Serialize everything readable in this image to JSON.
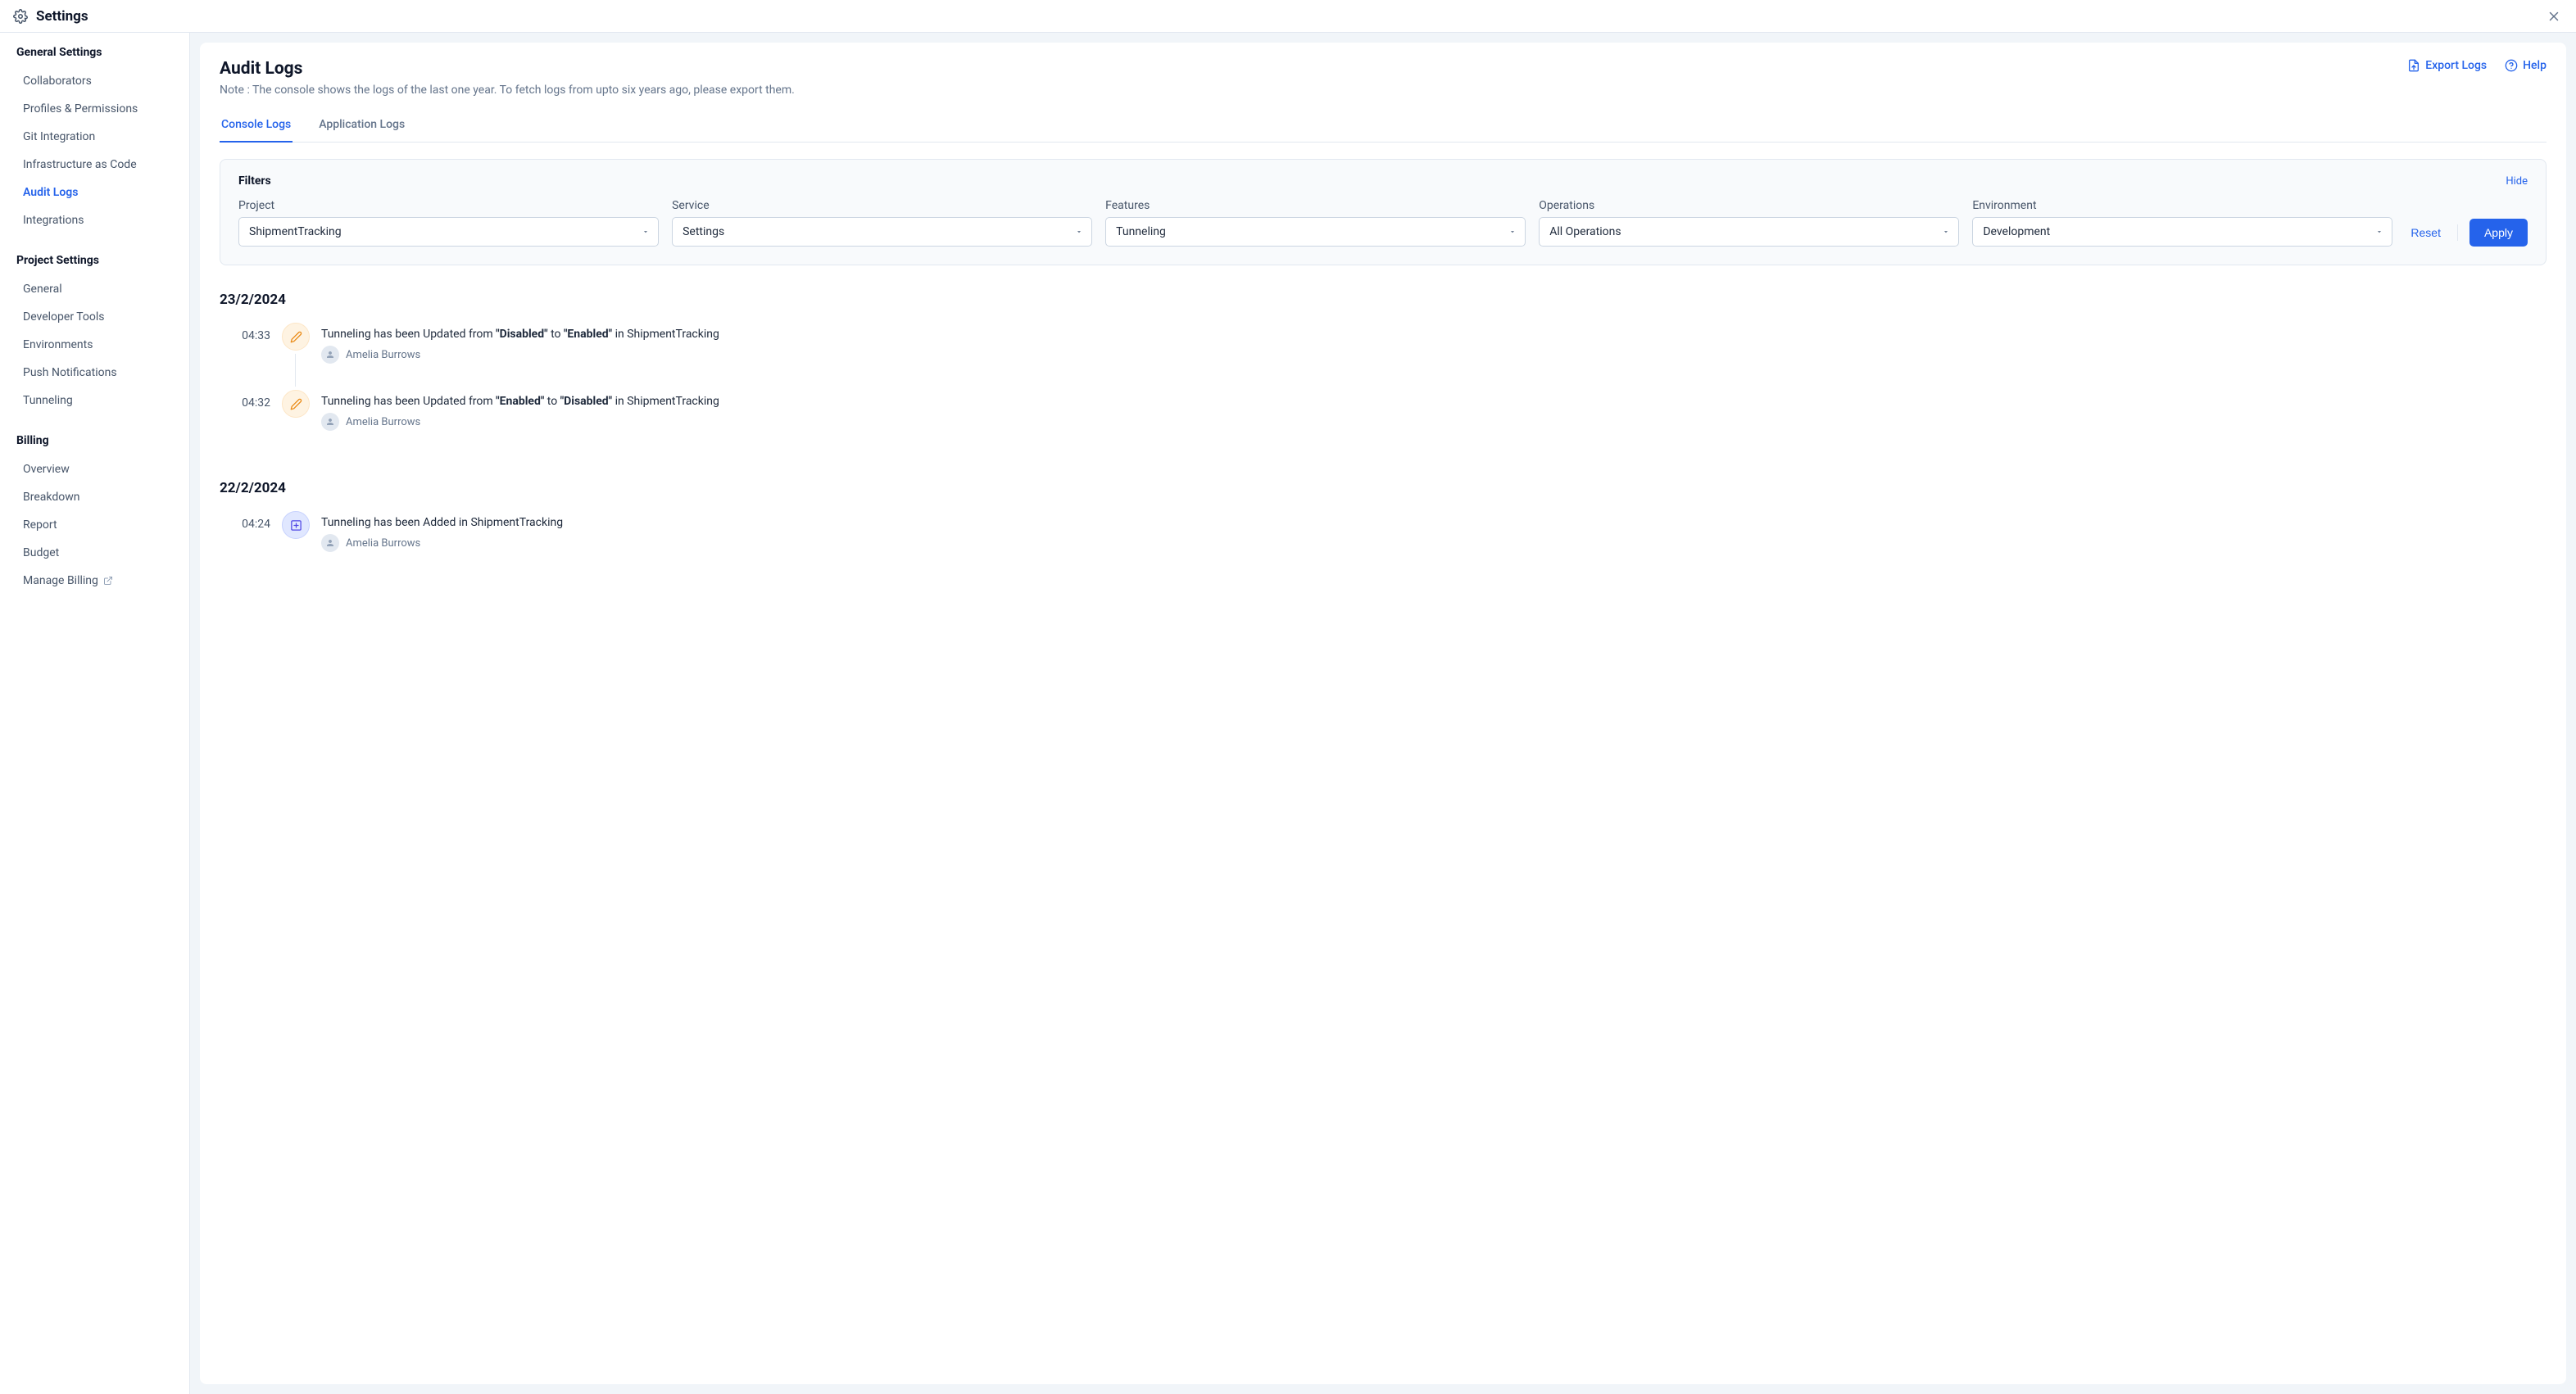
{
  "header": {
    "title": "Settings"
  },
  "sidebar": {
    "sections": [
      {
        "title": "General Settings",
        "items": [
          {
            "label": "Collaborators",
            "active": false,
            "external": false
          },
          {
            "label": "Profiles & Permissions",
            "active": false,
            "external": false
          },
          {
            "label": "Git Integration",
            "active": false,
            "external": false
          },
          {
            "label": "Infrastructure as Code",
            "active": false,
            "external": false
          },
          {
            "label": "Audit Logs",
            "active": true,
            "external": false
          },
          {
            "label": "Integrations",
            "active": false,
            "external": false
          }
        ]
      },
      {
        "title": "Project Settings",
        "items": [
          {
            "label": "General",
            "active": false,
            "external": false
          },
          {
            "label": "Developer Tools",
            "active": false,
            "external": false
          },
          {
            "label": "Environments",
            "active": false,
            "external": false
          },
          {
            "label": "Push Notifications",
            "active": false,
            "external": false
          },
          {
            "label": "Tunneling",
            "active": false,
            "external": false
          }
        ]
      },
      {
        "title": "Billing",
        "items": [
          {
            "label": "Overview",
            "active": false,
            "external": false
          },
          {
            "label": "Breakdown",
            "active": false,
            "external": false
          },
          {
            "label": "Report",
            "active": false,
            "external": false
          },
          {
            "label": "Budget",
            "active": false,
            "external": false
          },
          {
            "label": "Manage Billing",
            "active": false,
            "external": true
          }
        ]
      }
    ]
  },
  "page": {
    "title": "Audit Logs",
    "note": "Note : The console shows the logs of the last one year. To fetch logs from upto six years ago, please export them.",
    "export_label": "Export Logs",
    "help_label": "Help"
  },
  "tabs": [
    {
      "label": "Console Logs",
      "active": true
    },
    {
      "label": "Application Logs",
      "active": false
    }
  ],
  "filters": {
    "title": "Filters",
    "hide_label": "Hide",
    "fields": [
      {
        "label": "Project",
        "value": "ShipmentTracking"
      },
      {
        "label": "Service",
        "value": "Settings"
      },
      {
        "label": "Features",
        "value": "Tunneling"
      },
      {
        "label": "Operations",
        "value": "All Operations"
      },
      {
        "label": "Environment",
        "value": "Development"
      }
    ],
    "reset_label": "Reset",
    "apply_label": "Apply"
  },
  "log_groups": [
    {
      "date": "23/2/2024",
      "entries": [
        {
          "time": "04:33",
          "kind": "edit",
          "msg_pre": "Tunneling has been Updated from ",
          "bold1": "\"Disabled\"",
          "mid": " to ",
          "bold2": "\"Enabled\"",
          "msg_post": " in ShipmentTracking",
          "user": "Amelia Burrows",
          "connector": true
        },
        {
          "time": "04:32",
          "kind": "edit",
          "msg_pre": "Tunneling has been Updated from ",
          "bold1": "\"Enabled\"",
          "mid": " to ",
          "bold2": "\"Disabled\"",
          "msg_post": " in ShipmentTracking",
          "user": "Amelia Burrows",
          "connector": false
        }
      ]
    },
    {
      "date": "22/2/2024",
      "entries": [
        {
          "time": "04:24",
          "kind": "add",
          "msg_pre": "Tunneling has been Added in ShipmentTracking",
          "bold1": "",
          "mid": "",
          "bold2": "",
          "msg_post": "",
          "user": "Amelia Burrows",
          "connector": false
        }
      ]
    }
  ]
}
